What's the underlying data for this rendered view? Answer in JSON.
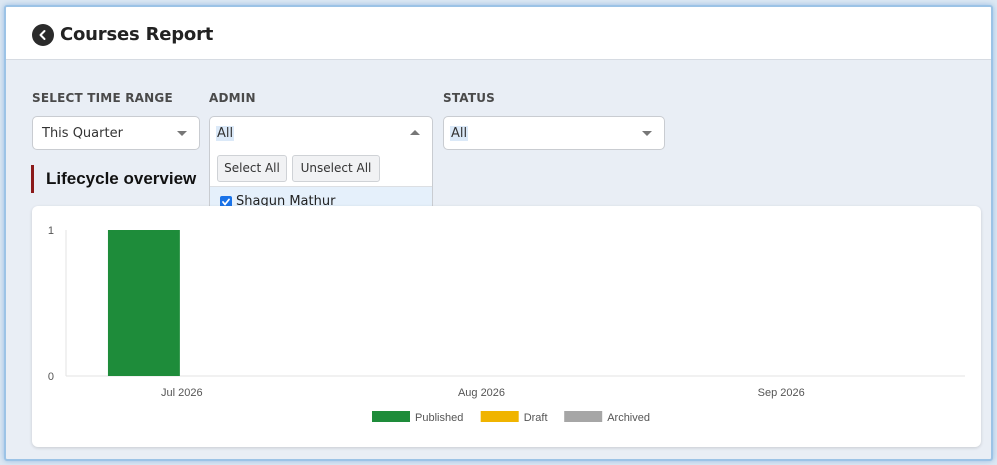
{
  "header": {
    "title": "Courses Report",
    "back_icon": "chevron-left-icon"
  },
  "filters": {
    "time_range": {
      "label": "SELECT TIME RANGE",
      "value": "This Quarter"
    },
    "admin": {
      "label": "ADMIN",
      "value": "All",
      "select_all_label": "Select All",
      "unselect_all_label": "Unselect All",
      "options": [
        {
          "label": "Shagun Mathur",
          "checked": true
        }
      ]
    },
    "status": {
      "label": "STATUS",
      "value": "All"
    }
  },
  "section": {
    "title": "Lifecycle overview",
    "accent": "#8b1a1a"
  },
  "chart_data": {
    "type": "bar",
    "categories": [
      "Jul 2026",
      "Aug 2026",
      "Sep 2026"
    ],
    "series": [
      {
        "name": "Published",
        "color": "#1e8c3a",
        "values": [
          1,
          0,
          0
        ]
      },
      {
        "name": "Draft",
        "color": "#f0b400",
        "values": [
          0,
          0,
          0
        ]
      },
      {
        "name": "Archived",
        "color": "#a6a6a6",
        "values": [
          0,
          0,
          0
        ]
      }
    ],
    "yticks": [
      "0",
      "1"
    ],
    "ylim": [
      0,
      1
    ],
    "grid": false,
    "legend": "bottom-center"
  }
}
